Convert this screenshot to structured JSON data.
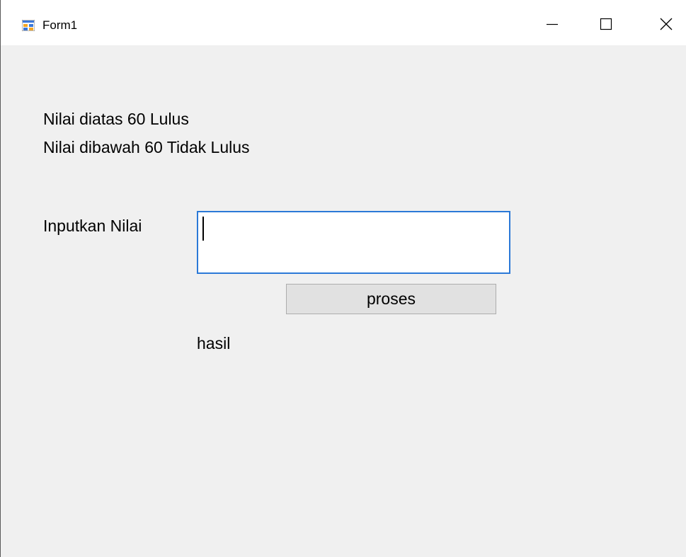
{
  "window": {
    "title": "Form1",
    "controls": {
      "minimize_icon": "minimize-icon",
      "maximize_icon": "maximize-icon",
      "close_icon": "close-icon"
    }
  },
  "form": {
    "info_line_1": "Nilai diatas 60 Lulus",
    "info_line_2": "Nilai dibawah 60 Tidak Lulus",
    "input_label": "Inputkan Nilai",
    "input_value": "",
    "button_label": "proses",
    "result_label": "hasil"
  },
  "colors": {
    "window_background": "#f0f0f0",
    "titlebar_background": "#ffffff",
    "input_border_focus": "#2b79d7",
    "button_background": "#e1e1e1"
  }
}
